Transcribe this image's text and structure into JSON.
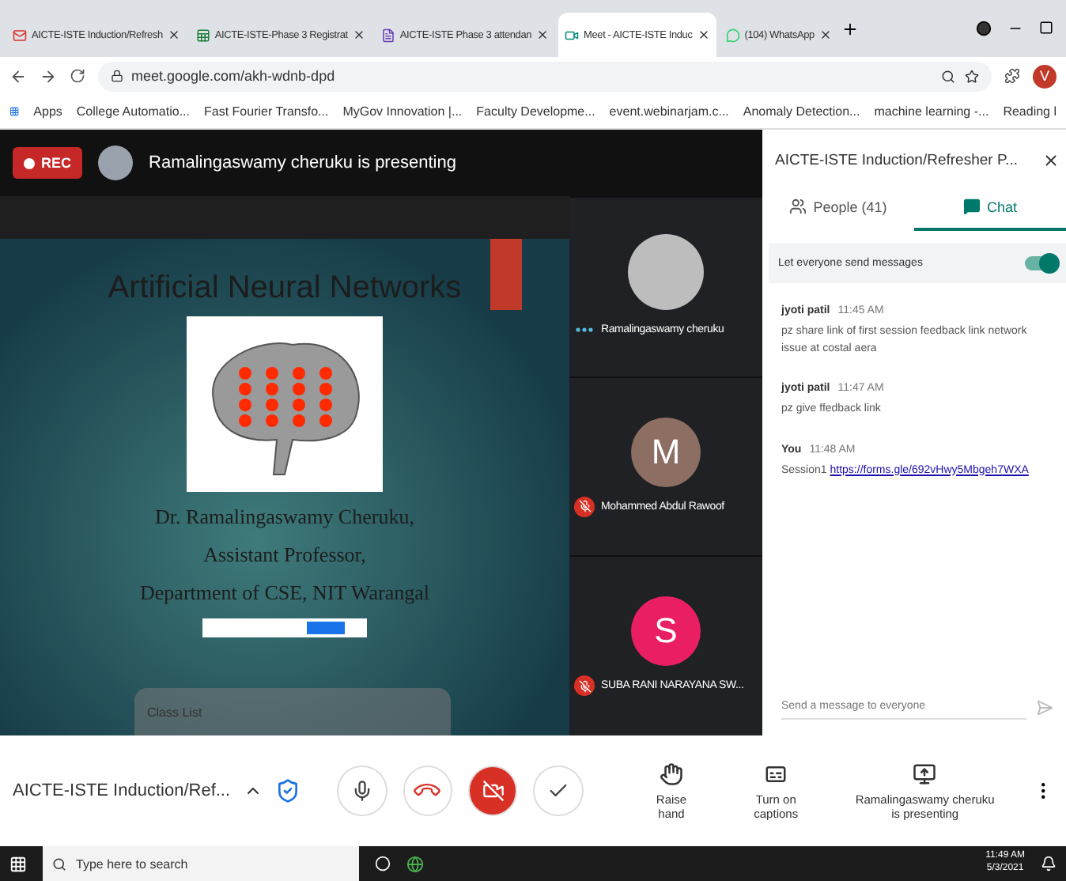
{
  "browser": {
    "tabs": [
      {
        "title": "AICTE-ISTE Induction/Refresh",
        "selected": false
      },
      {
        "title": "AICTE-ISTE-Phase 3 Registrat",
        "selected": false
      },
      {
        "title": "AICTE-ISTE Phase 3 attendan",
        "selected": false
      },
      {
        "title": "Meet - AICTE-ISTE Induc",
        "selected": true
      },
      {
        "title": "(104) WhatsApp",
        "selected": false
      }
    ],
    "address": "meet.google.com/akh-wdnb-dpd",
    "profile_letter": "V",
    "bookmarks": [
      "Apps",
      "College Automatio...",
      "Fast Fourier Transfo...",
      "MyGov Innovation |...",
      "Faculty Developme...",
      "event.webinarjam.c...",
      "Anomaly Detection...",
      "machine learning -..."
    ],
    "reading_list": "Reading l"
  },
  "meeting": {
    "recording_badge": "REC",
    "presenter_banner": "Ramalingaswamy cheruku is presenting",
    "slide": {
      "title": "Artificial Neural Networks",
      "lines": [
        "Dr. Ramalingaswamy Cheruku,",
        "Assistant Professor,",
        "Department of CSE, NIT Warangal"
      ]
    },
    "overlay_title": "Class List",
    "participants": [
      {
        "name": "Ramalingaswamy cheruku",
        "muted": false
      },
      {
        "name": "Mohammed Abdul Rawoof",
        "letter": "M",
        "color": "#8d6e63",
        "muted": true
      },
      {
        "name": "SUBA RANI NARAYANA SW...",
        "letter": "S",
        "color": "#e91e63",
        "muted": true
      }
    ]
  },
  "panel": {
    "title": "AICTE-ISTE Induction/Refresher P...",
    "tabs": [
      {
        "label": "People (41)",
        "selected": false
      },
      {
        "label": "Chat",
        "selected": true
      }
    ],
    "setting": {
      "label": "Let everyone send messages",
      "on": true
    },
    "messages": [
      {
        "sender": "jyoti patil",
        "time": "11:45 AM",
        "text": "pz share link of first session feedback link network issue at costal aera"
      },
      {
        "sender": "jyoti patil",
        "time": "11:47 AM",
        "text": "pz give ffedback link"
      },
      {
        "sender": "You",
        "time": "11:48 AM",
        "text": "Session1",
        "link": "https://forms.gle/692vHwy5Mbgeh7WXA"
      }
    ],
    "input_placeholder": "Send a message to everyone"
  },
  "controls": {
    "meeting_name": "AICTE-ISTE Induction/Ref...",
    "mic_on": true,
    "camera_on": false,
    "actions": [
      {
        "kind": "hand",
        "label": "Raise hand"
      },
      {
        "kind": "captions",
        "label": "Turn on captions"
      },
      {
        "kind": "present",
        "label": "Ramalingaswamy cheruku is presenting"
      }
    ]
  },
  "taskbar": {
    "search_placeholder": "Type here to search",
    "time": "11:49 AM",
    "date": "5/3/2021"
  }
}
